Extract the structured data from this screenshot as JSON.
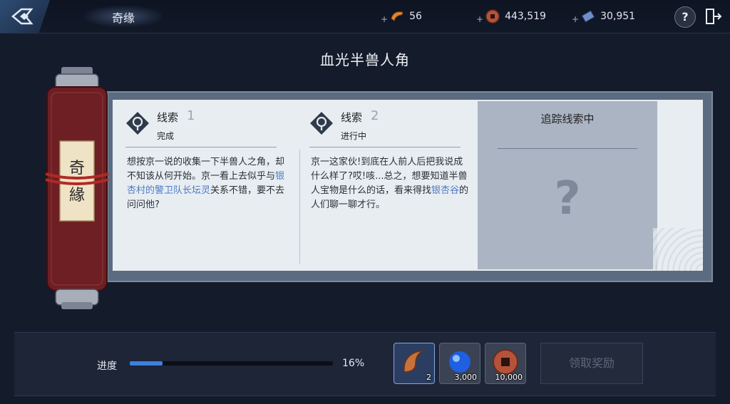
{
  "topbar": {
    "tab_title": "奇缘",
    "resources": [
      {
        "name": "horn-icon",
        "plus": "+",
        "value": "56"
      },
      {
        "name": "copper-coin-icon",
        "plus": "+",
        "value": "443,519"
      },
      {
        "name": "ticket-icon",
        "plus": "+",
        "value": "30,951"
      }
    ],
    "help": "?"
  },
  "heading": "血光半兽人角",
  "scroll": {
    "chars": "奇 緣"
  },
  "clues": [
    {
      "label": "线索",
      "number": "1",
      "status": "完成",
      "body_parts": [
        "想按京一说的收集一下半兽人之角，却不知该从何开始。京一看上去似乎与",
        "银杏村的警卫队长坛灵",
        "关系不错，要不去问问他?"
      ]
    },
    {
      "label": "线索",
      "number": "2",
      "status": "进行中",
      "body_parts": [
        "京一这家伙!到底在人前人后把我说成什么样了?哎!咳...总之，想要知道半兽人宝物是什么的话，看来得找",
        "银杏谷",
        "的人们聊一聊才行。"
      ]
    }
  ],
  "tracking": {
    "title": "追踪线索中",
    "placeholder": "?"
  },
  "progress": {
    "label": "进度",
    "percent": 16,
    "percent_text": "16%"
  },
  "rewards": [
    {
      "name": "horn-reward",
      "count": "2"
    },
    {
      "name": "blue-orb-reward",
      "count": "3,000"
    },
    {
      "name": "copper-coin-reward",
      "count": "10,000"
    }
  ],
  "claim_button": "领取奖励",
  "colors": {
    "accent": "#3d7fe0",
    "highlight_text": "#4f7cc4",
    "scroll_red": "#6e1f24"
  }
}
